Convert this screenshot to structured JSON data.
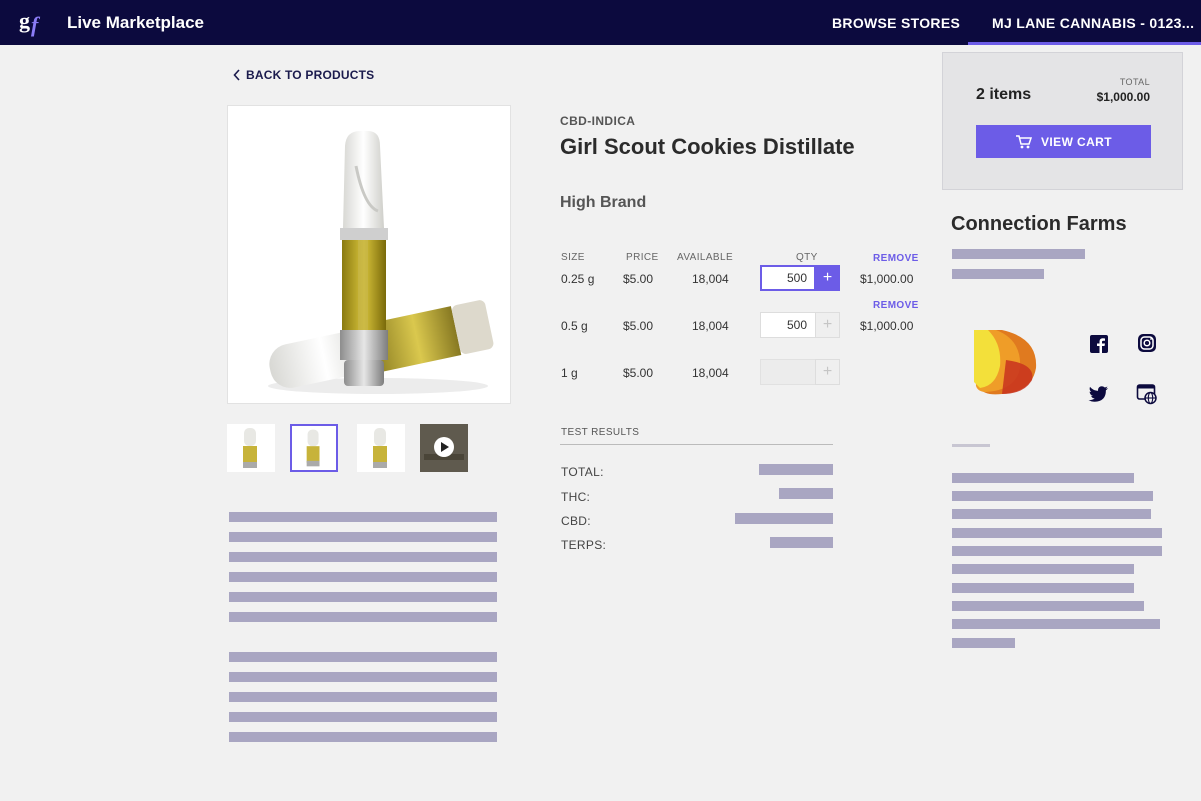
{
  "header": {
    "logo_text": "gf",
    "app_title": "Live Marketplace",
    "nav_browse": "BROWSE STORES",
    "nav_store": "MJ LANE CANNABIS - 0123..."
  },
  "back_link": "BACK TO PRODUCTS",
  "product": {
    "category": "CBD-INDICA",
    "name": "Girl Scout Cookies Distillate",
    "brand": "High Brand"
  },
  "variants_table": {
    "headers": {
      "size": "SIZE",
      "price": "PRICE",
      "available": "AVAILABLE",
      "qty": "QTY"
    },
    "remove_label": "REMOVE",
    "rows": [
      {
        "size": "0.25 g",
        "price": "$5.00",
        "available": "18,004",
        "qty": "500",
        "line_total": "$1,000.00"
      },
      {
        "size": "0.5 g",
        "price": "$5.00",
        "available": "18,004",
        "qty": "500",
        "line_total": "$1,000.00"
      },
      {
        "size": "1 g",
        "price": "$5.00",
        "available": "18,004",
        "qty": "",
        "line_total": ""
      }
    ]
  },
  "test_results": {
    "title": "TEST RESULTS",
    "labels": [
      "TOTAL:",
      "THC:",
      "CBD:",
      "TERPS:"
    ]
  },
  "cart": {
    "items": "2 items",
    "total_label": "TOTAL",
    "total": "$1,000.00",
    "view_cart": "VIEW CART"
  },
  "vendor": {
    "name": "Connection Farms"
  },
  "icons": {
    "back": "chevron-left-icon",
    "cart": "cart-icon",
    "play": "play-icon",
    "social": [
      "facebook-icon",
      "instagram-icon",
      "twitter-icon",
      "website-icon"
    ]
  },
  "colors": {
    "nav_bg": "#0c0a3e",
    "accent": "#6c5ce7",
    "placeholder_bar": "#a9a6c2",
    "page_bg": "#f1f1f1"
  }
}
